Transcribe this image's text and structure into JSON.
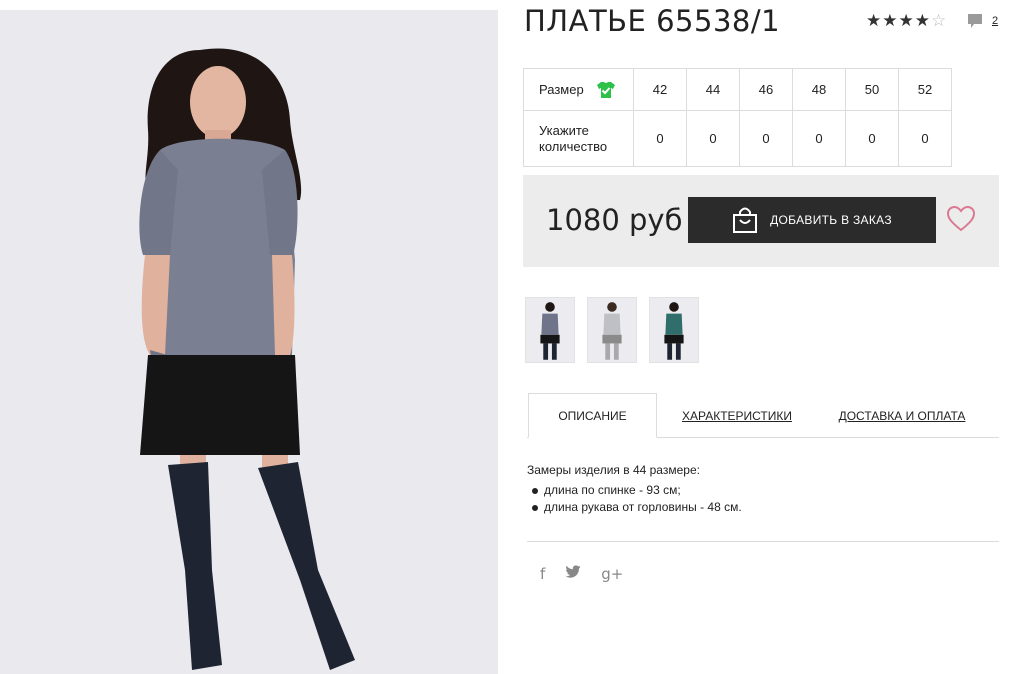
{
  "product": {
    "title": "ПЛАТЬЕ 65538/1",
    "rating": 4,
    "rating_max": 5,
    "comments_count": "2",
    "price": "1080 руб"
  },
  "sizes": {
    "size_label": "Размер",
    "qty_label_line1": "Укажите",
    "qty_label_line2": "количество",
    "values": [
      "42",
      "44",
      "46",
      "48",
      "50",
      "52"
    ],
    "quantities": [
      "0",
      "0",
      "0",
      "0",
      "0",
      "0"
    ]
  },
  "buy": {
    "add_button_label": "ДОБАВИТЬ В ЗАКАЗ"
  },
  "thumbnails": [
    "grey-dress",
    "light-grey-dress",
    "teal-dress"
  ],
  "tabs": [
    "ОПИСАНИЕ",
    "ХАРАКТЕРИСТИКИ",
    "ДОСТАВКА И ОПЛАТА"
  ],
  "description": {
    "intro": "Замеры изделия в 44 размере:",
    "items": [
      "длина по спинке - 93 см;",
      "длина рукава от горловины - 48 см."
    ]
  },
  "social": {
    "facebook": "f",
    "twitter": "🐦",
    "googleplus": "g+"
  },
  "colors": {
    "dark": "#2b2b2b",
    "panel": "#ececec",
    "border": "#dcdcdc",
    "check_green": "#2ec14a",
    "heart_pink": "#d97a93"
  }
}
